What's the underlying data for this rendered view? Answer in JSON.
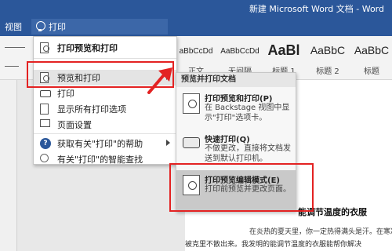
{
  "window": {
    "title": "新建 Microsoft Word 文档 - Word"
  },
  "ribbon": {
    "tab_view": "视图",
    "tell_me_value": "打印"
  },
  "styles": [
    {
      "preview": "aBbCcDd",
      "label": "正文"
    },
    {
      "preview": "AaBbCcDd",
      "label": "无间隔"
    },
    {
      "preview": "AaBl",
      "label": "标题 1"
    },
    {
      "preview": "AaBbC",
      "label": "标题 2"
    },
    {
      "preview": "AaBbC",
      "label": "标题"
    }
  ],
  "menu": {
    "top_item": "打印预览和打印",
    "items": [
      {
        "label": "预览和打印",
        "icon": "magnifier-doc-icon",
        "has_submenu": true
      },
      {
        "label": "打印",
        "icon": "printer-icon"
      },
      {
        "label": "显示所有打印选项",
        "icon": "list-icon"
      },
      {
        "label": "页面设置",
        "icon": "page-setup-icon"
      },
      {
        "label": "获取有关\"打印\"的帮助",
        "icon": "help-icon",
        "has_submenu": true
      },
      {
        "label": "有关\"打印\"的智能查找",
        "icon": "bulb-icon"
      }
    ]
  },
  "submenu": {
    "header": "预览并打印文档",
    "items": [
      {
        "title": "打印预览和打印(P)",
        "desc": "在 Backstage 视图中显示\"打印\"选项卡。"
      },
      {
        "title": "快速打印(Q)",
        "desc": "不做更改，直接将文档发送到默认打印机。"
      },
      {
        "title": "打印预览编辑模式(E)",
        "desc": "打印前预览并更改页面。"
      }
    ]
  },
  "document": {
    "heading": "能调节温度的衣服",
    "line1": "在炎热的夏天里，你一定热得满头是汗。在寒冷的冬",
    "line2": "被克里不散出来。我发明的能调节温度的衣服能帮你解决"
  },
  "colors": {
    "title_bar": "#2b579a",
    "highlight_box": "#e32222"
  }
}
